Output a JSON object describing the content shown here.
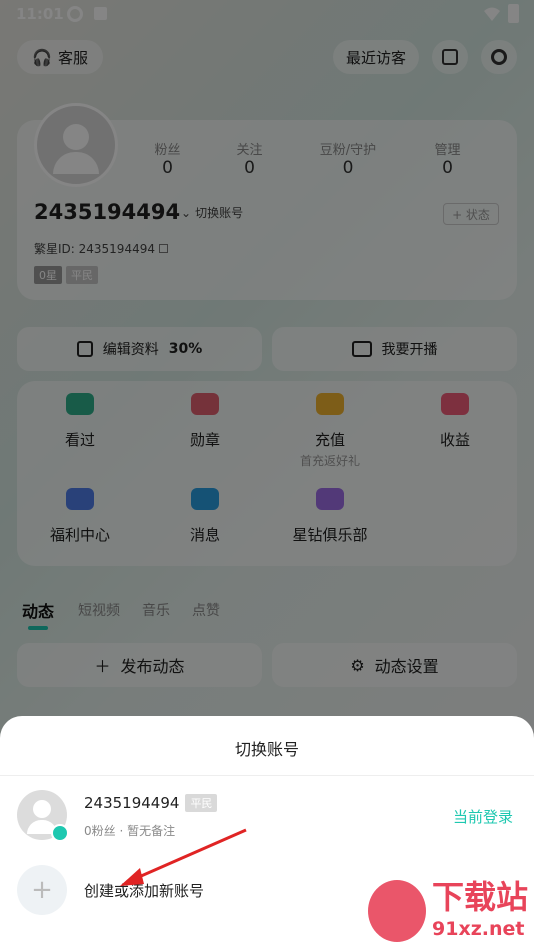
{
  "status_bar": {
    "time": "11:01"
  },
  "header": {
    "service_label": "客服",
    "recent_visitors_label": "最近访客"
  },
  "profile": {
    "stats": [
      {
        "label": "粉丝",
        "value": "0"
      },
      {
        "label": "关注",
        "value": "0"
      },
      {
        "label": "豆粉/守护",
        "value": "0"
      },
      {
        "label": "管理",
        "value": "0"
      }
    ],
    "user_id": "2435194494",
    "switch_account_label": "切换账号",
    "status_button_label": "+ 状态",
    "fanxing_id_label": "繁星ID: 2435194494",
    "star_badge": "0星",
    "rank_badge": "平民"
  },
  "actions": {
    "edit_profile": "编辑资料",
    "edit_percent": "30%",
    "go_live": "我要开播"
  },
  "grid": [
    {
      "label": "看过",
      "sub": "",
      "color": "#2fae8b"
    },
    {
      "label": "勋章",
      "sub": "",
      "color": "#e06070"
    },
    {
      "label": "充值",
      "sub": "首充返好礼",
      "color": "#f0b22e"
    },
    {
      "label": "收益",
      "sub": "",
      "color": "#ef5d79"
    },
    {
      "label": "福利中心",
      "sub": "",
      "color": "#4f7ee8"
    },
    {
      "label": "消息",
      "sub": "",
      "color": "#2a9ee0"
    },
    {
      "label": "星钻俱乐部",
      "sub": "",
      "color": "#9d6ee6"
    }
  ],
  "tabs": [
    "动态",
    "短视频",
    "音乐",
    "点赞"
  ],
  "bottom_buttons": {
    "publish": "发布动态",
    "settings": "动态设置"
  },
  "sheet": {
    "title": "切换账号",
    "account": {
      "name": "2435194494",
      "badge": "平民",
      "subtitle": "0粉丝 · 暂无备注",
      "current_label": "当前登录"
    },
    "add_label": "创建或添加新账号"
  },
  "watermark": {
    "brand_cn": "下载站",
    "domain": "91xz.net"
  },
  "colors": {
    "accent": "#1ec8b0",
    "arrow": "#e02424"
  }
}
